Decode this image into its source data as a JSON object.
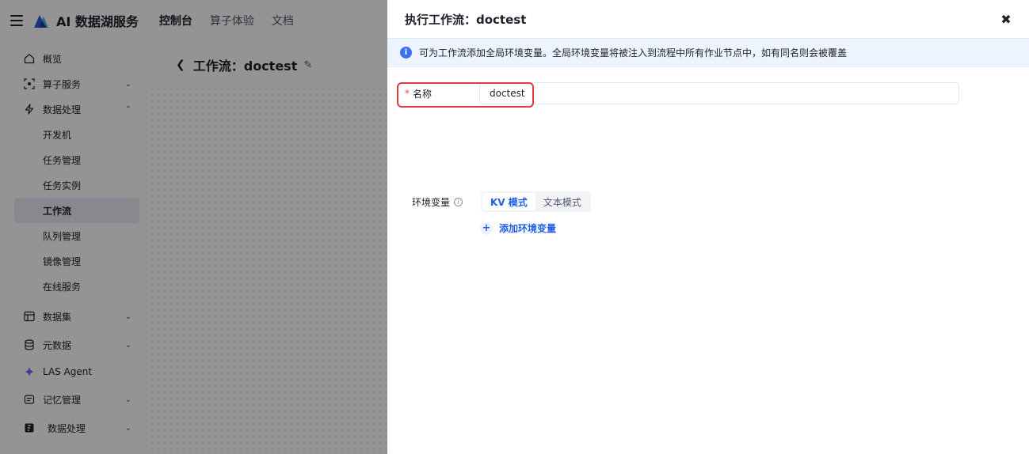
{
  "topbar": {
    "brand": "AI 数据湖服务",
    "nav": [
      "控制台",
      "算子体验",
      "文档"
    ]
  },
  "sidebar": {
    "items": [
      {
        "label": "概览",
        "icon": "home-icon"
      },
      {
        "label": "算子服务",
        "icon": "operator-icon"
      },
      {
        "label": "数据处理",
        "icon": "flash-icon"
      },
      {
        "label": "数据集",
        "icon": "table-icon"
      },
      {
        "label": "元数据",
        "icon": "database-icon"
      },
      {
        "label": "LAS Agent",
        "icon": "sparkle-icon"
      },
      {
        "label": "记忆管理",
        "icon": "memory-icon"
      },
      {
        "label": "数据处理",
        "icon": "data-process-icon"
      }
    ],
    "subitems": [
      "开发机",
      "任务管理",
      "任务实例",
      "工作流",
      "队列管理",
      "镜像管理",
      "在线服务"
    ],
    "active_sub": "工作流"
  },
  "main": {
    "title": "工作流：doctest"
  },
  "drawer": {
    "title": "执行工作流：doctest",
    "alert": "可为工作流添加全局环境变量。全局环境变量将被注入到流程中所有作业节点中，如有同名则会被覆盖",
    "name_label": "名称",
    "name_value": "doctest",
    "env_label": "环境变量",
    "modes": [
      "KV 模式",
      "文本模式"
    ],
    "active_mode": "KV 模式",
    "add_env": "添加环境变量"
  },
  "colors": {
    "accent": "#1f5fe0",
    "highlight": "#e03c3c",
    "required": "#f53f3f"
  }
}
